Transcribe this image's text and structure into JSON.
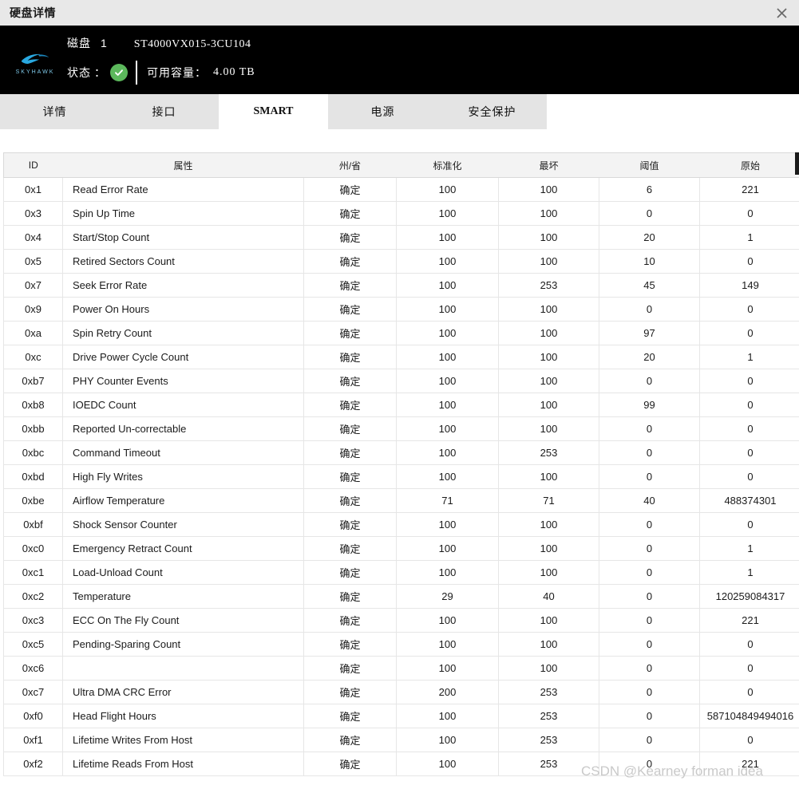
{
  "window": {
    "title": "硬盘详情",
    "close_icon": "close-icon"
  },
  "device": {
    "brand": "SKYHAWK",
    "disk_label": "磁盘",
    "disk_index": "1",
    "model": "ST4000VX015-3CU104",
    "status_label": "状态",
    "status_colon": "：",
    "status_icon": "check-circle-icon",
    "capacity_label": "可用容量：",
    "capacity_value": "4.00 TB"
  },
  "tabs": [
    {
      "label": "详情",
      "active": false
    },
    {
      "label": "接口",
      "active": false
    },
    {
      "label": "SMART",
      "active": true
    },
    {
      "label": "电源",
      "active": false
    },
    {
      "label": "安全保护",
      "active": false
    }
  ],
  "table": {
    "headers": [
      "ID",
      "属性",
      "州/省",
      "标准化",
      "最坏",
      "阈值",
      "原始"
    ],
    "rows": [
      {
        "id": "0x1",
        "attribute": "Read Error Rate",
        "state": "确定",
        "normalized": "100",
        "worst": "100",
        "threshold": "6",
        "raw": "221"
      },
      {
        "id": "0x3",
        "attribute": "Spin Up Time",
        "state": "确定",
        "normalized": "100",
        "worst": "100",
        "threshold": "0",
        "raw": "0"
      },
      {
        "id": "0x4",
        "attribute": "Start/Stop Count",
        "state": "确定",
        "normalized": "100",
        "worst": "100",
        "threshold": "20",
        "raw": "1"
      },
      {
        "id": "0x5",
        "attribute": "Retired Sectors Count",
        "state": "确定",
        "normalized": "100",
        "worst": "100",
        "threshold": "10",
        "raw": "0"
      },
      {
        "id": "0x7",
        "attribute": "Seek Error Rate",
        "state": "确定",
        "normalized": "100",
        "worst": "253",
        "threshold": "45",
        "raw": "149"
      },
      {
        "id": "0x9",
        "attribute": "Power On Hours",
        "state": "确定",
        "normalized": "100",
        "worst": "100",
        "threshold": "0",
        "raw": "0"
      },
      {
        "id": "0xa",
        "attribute": "Spin Retry Count",
        "state": "确定",
        "normalized": "100",
        "worst": "100",
        "threshold": "97",
        "raw": "0"
      },
      {
        "id": "0xc",
        "attribute": "Drive Power Cycle Count",
        "state": "确定",
        "normalized": "100",
        "worst": "100",
        "threshold": "20",
        "raw": "1"
      },
      {
        "id": "0xb7",
        "attribute": "PHY Counter Events",
        "state": "确定",
        "normalized": "100",
        "worst": "100",
        "threshold": "0",
        "raw": "0"
      },
      {
        "id": "0xb8",
        "attribute": "IOEDC Count",
        "state": "确定",
        "normalized": "100",
        "worst": "100",
        "threshold": "99",
        "raw": "0"
      },
      {
        "id": "0xbb",
        "attribute": "Reported Un-correctable",
        "state": "确定",
        "normalized": "100",
        "worst": "100",
        "threshold": "0",
        "raw": "0"
      },
      {
        "id": "0xbc",
        "attribute": "Command Timeout",
        "state": "确定",
        "normalized": "100",
        "worst": "253",
        "threshold": "0",
        "raw": "0"
      },
      {
        "id": "0xbd",
        "attribute": "High Fly Writes",
        "state": "确定",
        "normalized": "100",
        "worst": "100",
        "threshold": "0",
        "raw": "0"
      },
      {
        "id": "0xbe",
        "attribute": "Airflow Temperature",
        "state": "确定",
        "normalized": "71",
        "worst": "71",
        "threshold": "40",
        "raw": "488374301"
      },
      {
        "id": "0xbf",
        "attribute": "Shock Sensor Counter",
        "state": "确定",
        "normalized": "100",
        "worst": "100",
        "threshold": "0",
        "raw": "0"
      },
      {
        "id": "0xc0",
        "attribute": "Emergency Retract Count",
        "state": "确定",
        "normalized": "100",
        "worst": "100",
        "threshold": "0",
        "raw": "1"
      },
      {
        "id": "0xc1",
        "attribute": "Load-Unload Count",
        "state": "确定",
        "normalized": "100",
        "worst": "100",
        "threshold": "0",
        "raw": "1"
      },
      {
        "id": "0xc2",
        "attribute": "Temperature",
        "state": "确定",
        "normalized": "29",
        "worst": "40",
        "threshold": "0",
        "raw": "120259084317"
      },
      {
        "id": "0xc3",
        "attribute": "ECC On The Fly Count",
        "state": "确定",
        "normalized": "100",
        "worst": "100",
        "threshold": "0",
        "raw": "221"
      },
      {
        "id": "0xc5",
        "attribute": "Pending-Sparing Count",
        "state": "确定",
        "normalized": "100",
        "worst": "100",
        "threshold": "0",
        "raw": "0"
      },
      {
        "id": "0xc6",
        "attribute": "",
        "state": "确定",
        "normalized": "100",
        "worst": "100",
        "threshold": "0",
        "raw": "0"
      },
      {
        "id": "0xc7",
        "attribute": "Ultra DMA CRC Error",
        "state": "确定",
        "normalized": "200",
        "worst": "253",
        "threshold": "0",
        "raw": "0"
      },
      {
        "id": "0xf0",
        "attribute": "Head Flight Hours",
        "state": "确定",
        "normalized": "100",
        "worst": "253",
        "threshold": "0",
        "raw": "587104849494016"
      },
      {
        "id": "0xf1",
        "attribute": "Lifetime Writes From Host",
        "state": "确定",
        "normalized": "100",
        "worst": "253",
        "threshold": "0",
        "raw": "0"
      },
      {
        "id": "0xf2",
        "attribute": "Lifetime Reads From Host",
        "state": "确定",
        "normalized": "100",
        "worst": "253",
        "threshold": "0",
        "raw": "221"
      }
    ]
  },
  "watermark": {
    "text": "CSDN @Kearney forman idea"
  },
  "colors": {
    "status_green": "#5cb85c",
    "brand_blue": "#2aa3d8",
    "header_black": "#000000",
    "tab_inactive": "#e4e4e4"
  }
}
